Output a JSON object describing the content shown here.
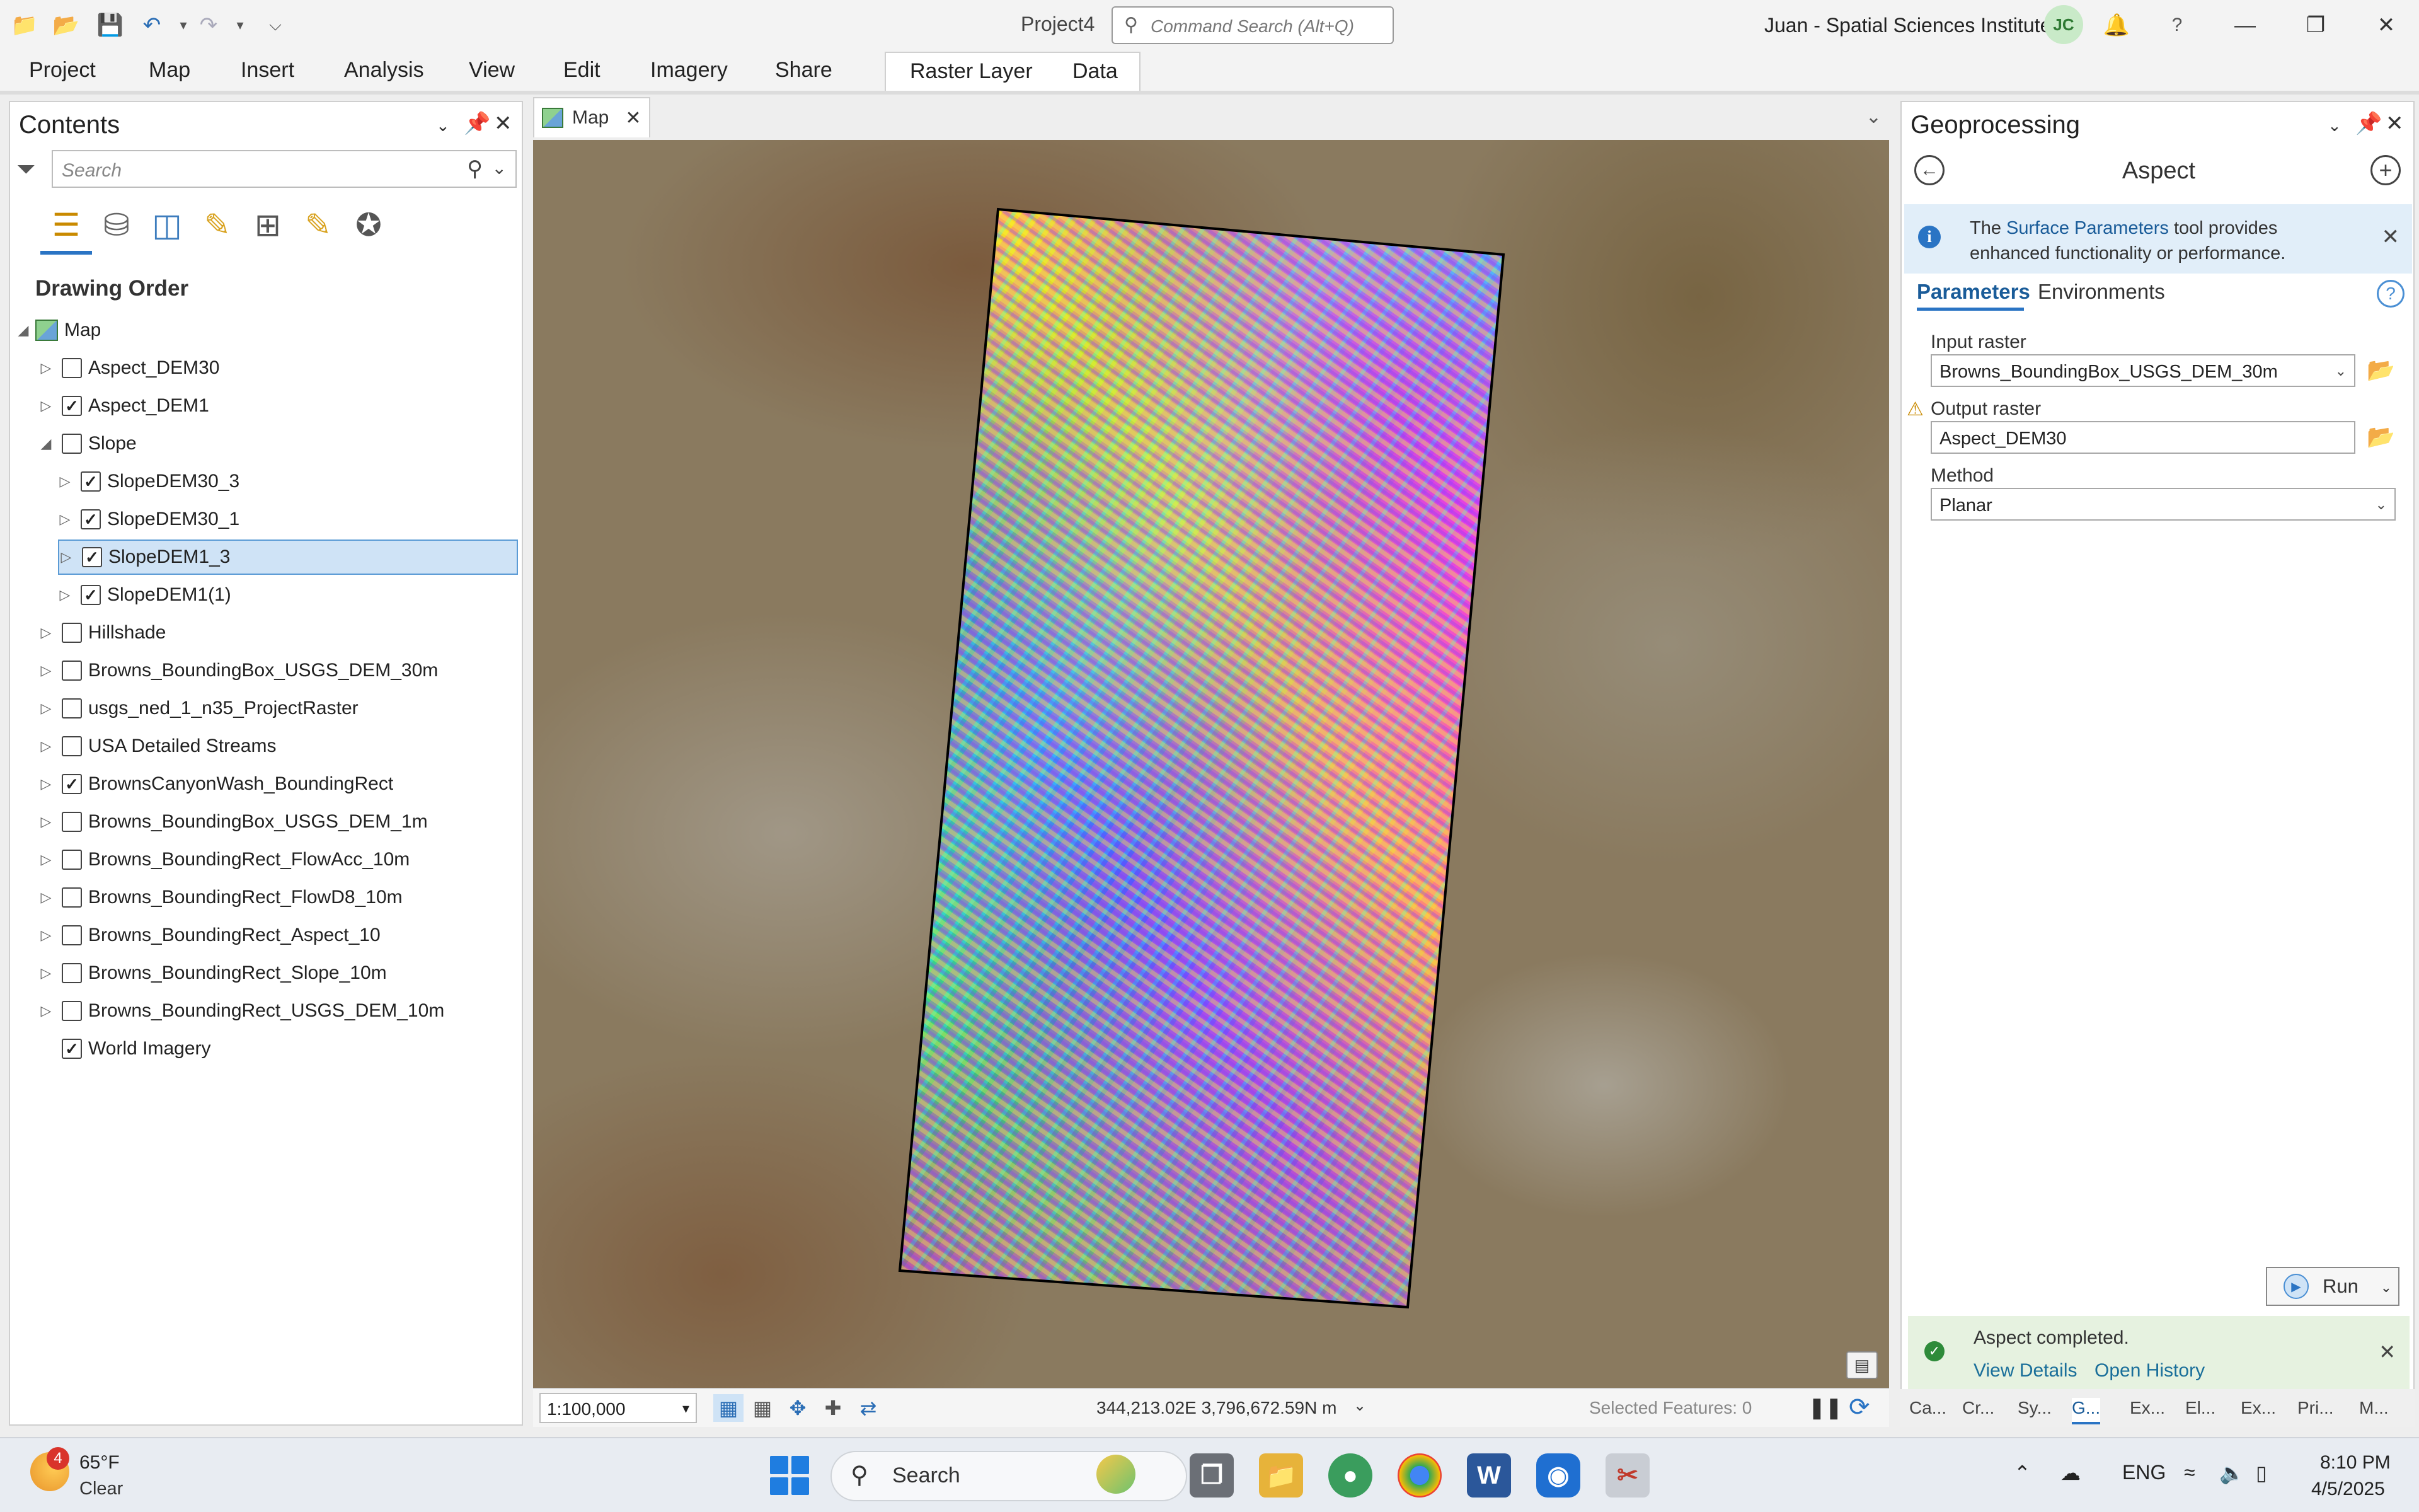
{
  "titlebar": {
    "project_title": "Project4",
    "command_search_placeholder": "Command Search (Alt+Q)",
    "user": "Juan - Spatial Sciences Institute",
    "avatar_initials": "JC",
    "help": "?"
  },
  "ribbon": {
    "tabs": [
      "Project",
      "Map",
      "Insert",
      "Analysis",
      "View",
      "Edit",
      "Imagery",
      "Share"
    ],
    "contextual_tabs": [
      "Raster Layer",
      "Data"
    ]
  },
  "contents": {
    "title": "Contents",
    "search_placeholder": "Search",
    "section": "Drawing Order",
    "map_label": "Map",
    "layers": [
      {
        "name": "Aspect_DEM30",
        "checked": false,
        "level": 1,
        "expander": "right"
      },
      {
        "name": "Aspect_DEM1",
        "checked": true,
        "level": 1,
        "expander": "right"
      },
      {
        "name": "Slope",
        "checked": false,
        "level": 1,
        "expander": "down"
      },
      {
        "name": "SlopeDEM30_3",
        "checked": true,
        "level": 2,
        "expander": "right"
      },
      {
        "name": "SlopeDEM30_1",
        "checked": true,
        "level": 2,
        "expander": "right"
      },
      {
        "name": "SlopeDEM1_3",
        "checked": true,
        "level": 2,
        "expander": "right",
        "selected": true
      },
      {
        "name": "SlopeDEM1(1)",
        "checked": true,
        "level": 2,
        "expander": "right"
      },
      {
        "name": "Hillshade",
        "checked": false,
        "level": 1,
        "expander": "right"
      },
      {
        "name": "Browns_BoundingBox_USGS_DEM_30m",
        "checked": false,
        "level": 1,
        "expander": "right"
      },
      {
        "name": "usgs_ned_1_n35_ProjectRaster",
        "checked": false,
        "level": 1,
        "expander": "right"
      },
      {
        "name": "USA Detailed Streams",
        "checked": false,
        "level": 1,
        "expander": "right"
      },
      {
        "name": "BrownsCanyonWash_BoundingRect",
        "checked": true,
        "level": 1,
        "expander": "right"
      },
      {
        "name": "Browns_BoundingBox_USGS_DEM_1m",
        "checked": false,
        "level": 1,
        "expander": "right"
      },
      {
        "name": "Browns_BoundingRect_FlowAcc_10m",
        "checked": false,
        "level": 1,
        "expander": "right"
      },
      {
        "name": "Browns_BoundingRect_FlowD8_10m",
        "checked": false,
        "level": 1,
        "expander": "right"
      },
      {
        "name": "Browns_BoundingRect_Aspect_10",
        "checked": false,
        "level": 1,
        "expander": "right"
      },
      {
        "name": "Browns_BoundingRect_Slope_10m",
        "checked": false,
        "level": 1,
        "expander": "right"
      },
      {
        "name": "Browns_BoundingRect_USGS_DEM_10m",
        "checked": false,
        "level": 1,
        "expander": "right"
      },
      {
        "name": "World Imagery",
        "checked": true,
        "level": 1,
        "expander": "none"
      }
    ]
  },
  "map": {
    "tab_label": "Map",
    "scale": "1:100,000",
    "coordinates": "344,213.02E 3,796,672.59N m",
    "selected_features": "Selected Features: 0"
  },
  "geoprocessing": {
    "title": "Geoprocessing",
    "tool_name": "Aspect",
    "info_pre": "The ",
    "info_link": "Surface Parameters",
    "info_post": " tool provides enhanced functionality or performance.",
    "tabs": [
      "Parameters",
      "Environments"
    ],
    "params": {
      "input_raster_label": "Input raster",
      "input_raster_value": "Browns_BoundingBox_USGS_DEM_30m",
      "output_raster_label": "Output raster",
      "output_raster_value": "Aspect_DEM30",
      "method_label": "Method",
      "method_value": "Planar"
    },
    "run_label": "Run",
    "status_message": "Aspect completed.",
    "status_links": [
      "View Details",
      "Open History"
    ]
  },
  "dock_tabs": [
    "Ca...",
    "Cr...",
    "Sy...",
    "G...",
    "Ex...",
    "El...",
    "Ex...",
    "Pri...",
    "M..."
  ],
  "taskbar": {
    "weather_badge": "4",
    "temperature": "65°F",
    "condition": "Clear",
    "search_label": "Search",
    "language": "ENG",
    "time": "8:10 PM",
    "date": "4/5/2025"
  }
}
